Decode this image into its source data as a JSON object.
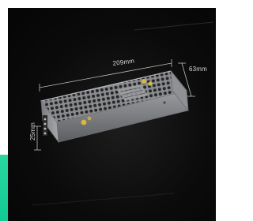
{
  "image": {
    "subject": "led-power-supply-unit",
    "background_color": "#0a0a0a",
    "accent_color": "#18cf98",
    "dimensions": {
      "width_label": "209mm",
      "depth_label": "63mm",
      "height_label": "25mm"
    }
  }
}
